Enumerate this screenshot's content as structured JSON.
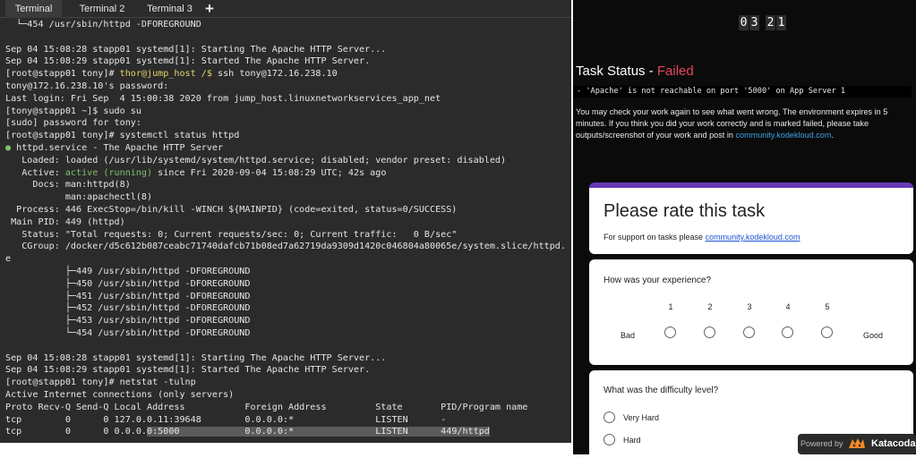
{
  "terminal": {
    "tabs": [
      "Terminal",
      "Terminal 2",
      "Terminal 3"
    ],
    "add_tab_label": "+",
    "lines": {
      "l0": "  └─454 /usr/sbin/httpd -DFOREGROUND",
      "l1": "",
      "l2": "Sep 04 15:08:28 stapp01 systemd[1]: Starting The Apache HTTP Server...",
      "l3": "Sep 04 15:08:29 stapp01 systemd[1]: Started The Apache HTTP Server.",
      "l4_a": "[root@stapp01 tony]# ",
      "l4_b": "thor@jump_host /$",
      "l4_c": " ssh tony@172.16.238.10",
      "l5": "tony@172.16.238.10's password:",
      "l6": "Last login: Fri Sep  4 15:00:38 2020 from jump_host.linuxnetworkservices_app_net",
      "l7": "[tony@stapp01 ~]$ sudo su",
      "l8": "[sudo] password for tony:",
      "l9": "[root@stapp01 tony]# systemctl status httpd",
      "l10_a": "●",
      "l10_b": " httpd.service - The Apache HTTP Server",
      "l11": "   Loaded: loaded (/usr/lib/systemd/system/httpd.service; disabled; vendor preset: disabled)",
      "l12_a": "   Active: ",
      "l12_b": "active (running)",
      "l12_c": " since Fri 2020-09-04 15:08:29 UTC; 42s ago",
      "l13": "     Docs: man:httpd(8)",
      "l14": "           man:apachectl(8)",
      "l15": "  Process: 446 ExecStop=/bin/kill -WINCH ${MAINPID} (code=exited, status=0/SUCCESS)",
      "l16": " Main PID: 449 (httpd)",
      "l17": "   Status: \"Total requests: 0; Current requests/sec: 0; Current traffic:   0 B/sec\"",
      "l18": "   CGroup: /docker/d5c612b087ceabc71740dafcb71b08ed7a62719da9309d1420c046804a80065e/system.slice/httpd.servic",
      "l19": "e",
      "l20": "           ├─449 /usr/sbin/httpd -DFOREGROUND",
      "l21": "           ├─450 /usr/sbin/httpd -DFOREGROUND",
      "l22": "           ├─451 /usr/sbin/httpd -DFOREGROUND",
      "l23": "           ├─452 /usr/sbin/httpd -DFOREGROUND",
      "l24": "           ├─453 /usr/sbin/httpd -DFOREGROUND",
      "l25": "           └─454 /usr/sbin/httpd -DFOREGROUND",
      "l26": "",
      "l27": "Sep 04 15:08:28 stapp01 systemd[1]: Starting The Apache HTTP Server...",
      "l28": "Sep 04 15:08:29 stapp01 systemd[1]: Started The Apache HTTP Server.",
      "l29": "[root@stapp01 tony]# netstat -tulnp",
      "l30": "Active Internet connections (only servers)",
      "l31": "Proto Recv-Q Send-Q Local Address           Foreign Address         State       PID/Program name",
      "l32": "tcp        0      0 127.0.0.11:39648        0.0.0.0:*               LISTEN      -",
      "l33_a": "tcp        0      0 0.0.0.",
      "l33_b": "0:5000            0.0.0.0:*               LISTEN      449/httpd"
    }
  },
  "task": {
    "timer_digits": [
      "0",
      "3",
      "2",
      "1"
    ],
    "status_label": "Task Status - ",
    "status_value": "Failed",
    "message": "- 'Apache' is not reachable on port '5000' on App Server 1",
    "note_text": "You may check your work again to see what went wrong. The environment expires in 5 minutes. If you think you did your work correctly and is marked failed, please take outputs/screenshot of your work and post in ",
    "note_link": "community.kodekloud.com",
    "note_end": "."
  },
  "form": {
    "title": "Please rate this task",
    "support_text": "For support on tasks please ",
    "support_link": "community.kodekloud.com",
    "experience_question": "How was your experience?",
    "scale": [
      "1",
      "2",
      "3",
      "4",
      "5"
    ],
    "scale_low": "Bad",
    "scale_high": "Good",
    "difficulty_question": "What was the difficulty level?",
    "difficulty_options": [
      "Very Hard",
      "Hard"
    ]
  },
  "badge": {
    "powered_by": "Powered by",
    "brand": "Katacoda"
  },
  "colors": {
    "failed": "#e5475a",
    "running": "#7ec16a",
    "prompt_user": "#e3d266",
    "link": "#3ea0e6",
    "form_accent": "#673ab7"
  }
}
